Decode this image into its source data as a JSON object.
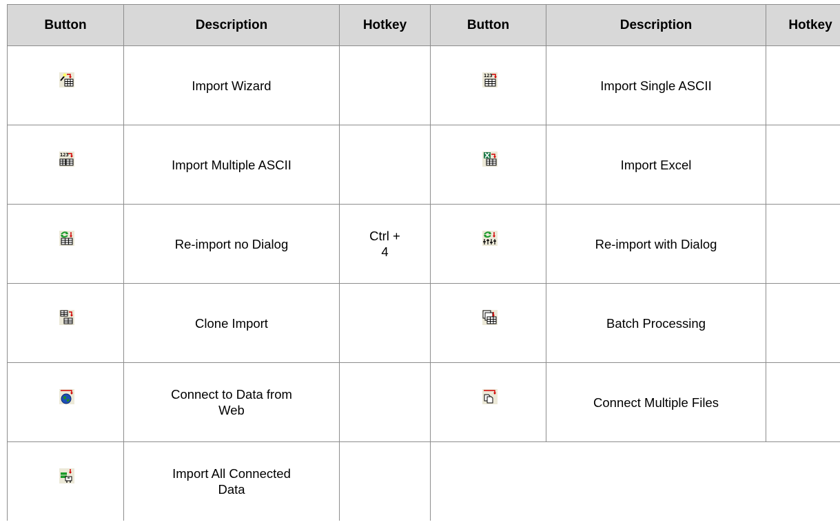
{
  "headers": [
    "Button",
    "Description",
    "Hotkey",
    "Button",
    "Description",
    "Hotkey"
  ],
  "rows": [
    {
      "left": {
        "icon": "import-wizard-icon",
        "description": "Import Wizard",
        "hotkey": ""
      },
      "right": {
        "icon": "import-single-ascii-icon",
        "description": "Import Single ASCII",
        "hotkey": ""
      }
    },
    {
      "left": {
        "icon": "import-multiple-ascii-icon",
        "description": "Import Multiple ASCII",
        "hotkey": ""
      },
      "right": {
        "icon": "import-excel-icon",
        "description": "Import Excel",
        "hotkey": ""
      }
    },
    {
      "left": {
        "icon": "reimport-no-dialog-icon",
        "description": "Re-import no Dialog",
        "hotkey": "Ctrl + 4"
      },
      "right": {
        "icon": "reimport-with-dialog-icon",
        "description": "Re-import with Dialog",
        "hotkey": ""
      }
    },
    {
      "left": {
        "icon": "clone-import-icon",
        "description": "Clone Import",
        "hotkey": ""
      },
      "right": {
        "icon": "batch-processing-icon",
        "description": "Batch Processing",
        "hotkey": ""
      }
    },
    {
      "left": {
        "icon": "connect-web-data-icon",
        "description": "Connect to Data from Web",
        "hotkey": ""
      },
      "right": {
        "icon": "connect-multiple-files-icon",
        "description": "Connect Multiple Files",
        "hotkey": ""
      }
    },
    {
      "left": {
        "icon": "import-all-connected-icon",
        "description": "Import All Connected Data",
        "hotkey": ""
      }
    }
  ]
}
